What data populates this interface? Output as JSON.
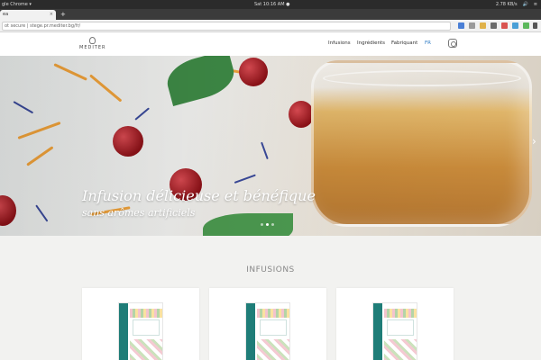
{
  "os": {
    "app_name": "gle Chrome ▾",
    "clock": "Sat 10:16 AM ●",
    "tray": [
      "2.78 KB/s",
      "🔊",
      "≡"
    ]
  },
  "browser": {
    "tab_title": "ea",
    "tab_close": "×",
    "new_tab": "+",
    "url": "ot secure | stege.pr.mediter.bg/fr/"
  },
  "site": {
    "logo_text": "MEDITER",
    "nav": [
      "Infusions",
      "Ingrédients",
      "Fabriquant",
      "FR"
    ],
    "instagram_icon": "instagram-icon"
  },
  "hero": {
    "title": "Infusion délicieuse et bénéfique",
    "subtitle": "sans arômes artificiels",
    "next_arrow": "›",
    "slides_total": 3,
    "slide_active": 2
  },
  "infusions": {
    "heading": "INFUSIONS",
    "products": [
      {
        "accent": "#1f7d78"
      },
      {
        "accent": "#1f7d78"
      },
      {
        "accent": "#1f7d78"
      }
    ]
  }
}
